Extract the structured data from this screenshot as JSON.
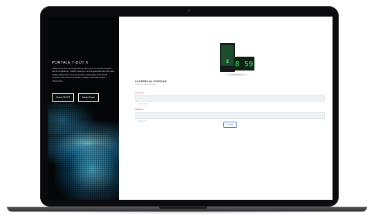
{
  "left_panel": {
    "title": "PORTALE T-DOT X",
    "paragraphs": [
      "I display Dooh 3D e nuova generazione offrono per un'immersiva visualità in tutte le configurazioni, modello moderno in cui si progetta dispositivi informativi.",
      "I display Media Vision consente la fruizione della display Dooh 3D DIT, immersivo ed al contesto circondato, il display in ottica di immagine e collegamento."
    ],
    "buttons": [
      "Chiedi 3D DIT",
      "Media Portal"
    ]
  },
  "device": {
    "screen_text": "8",
    "panel_text": "8 59"
  },
  "login": {
    "title": "ACCESSO AL PORTALE",
    "subtitle": "Inserisci le tue credenziali",
    "username_label": "User name",
    "username_placeholder": "User name",
    "password_label": "Password",
    "password_placeholder": "Password",
    "submit_label": "ACCEDI"
  },
  "colors": {
    "label_accent": "#b2432c",
    "button_border": "#4a78c2",
    "led_green": "#25d15b"
  }
}
